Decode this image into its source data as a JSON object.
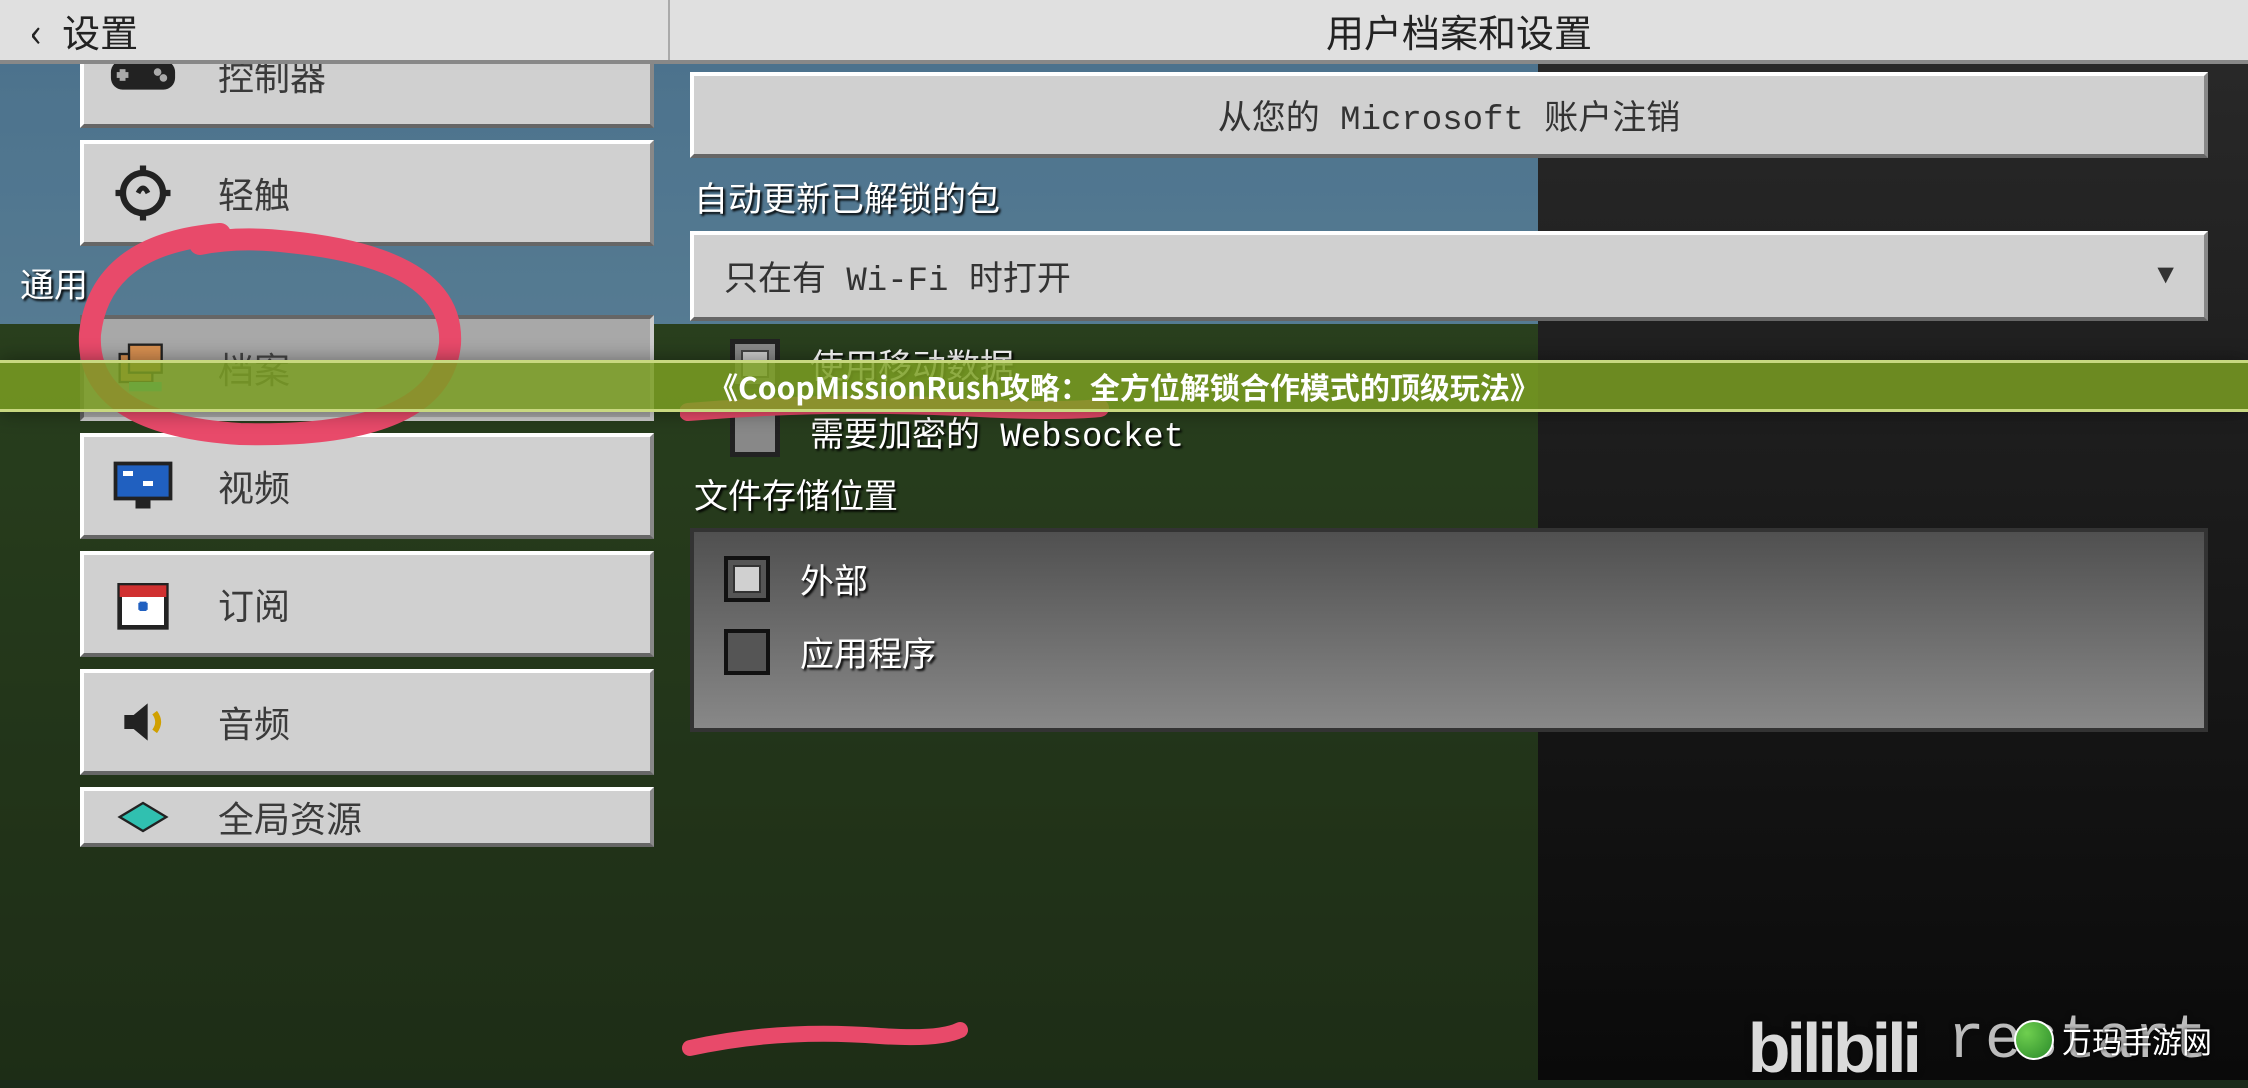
{
  "header": {
    "back_label": "设置",
    "title": "用户档案和设置"
  },
  "sidebar": {
    "section_general": "通用",
    "items": {
      "controller": "控制器",
      "touch": "轻触",
      "profile": "档案",
      "video": "视频",
      "subscribe": "订阅",
      "audio": "音频",
      "global": "全局资源"
    }
  },
  "main": {
    "signout_button": "从您的 Microsoft 账户注销",
    "autoupdate_label": "自动更新已解锁的包",
    "autoupdate_value": "只在有 Wi-Fi 时打开",
    "mobile_data_label": "使用移动数据",
    "websocket_label": "需要加密的 Websocket",
    "storage_label": "文件存储位置",
    "storage_options": {
      "external": "外部",
      "app": "应用程序"
    }
  },
  "banner": "《CoopMissionRush攻略：全方位解锁合作模式的顶级玩法》",
  "watermarks": {
    "bilibili": "bilibili",
    "restart": "restart",
    "site": "万玛手游网"
  }
}
